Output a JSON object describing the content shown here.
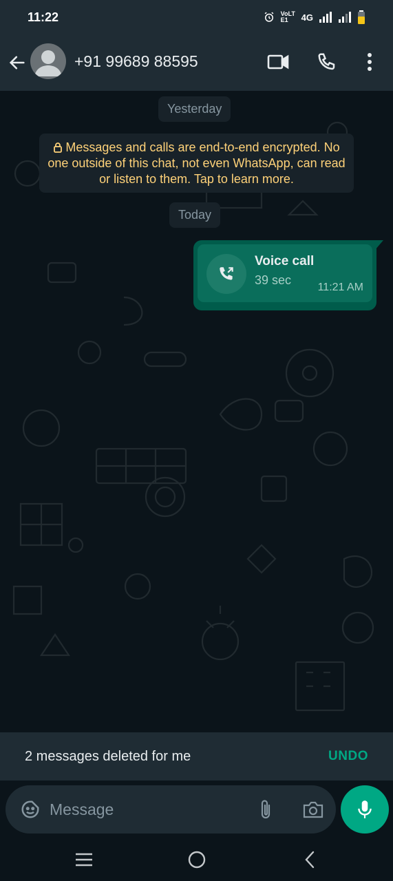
{
  "status_bar": {
    "time": "11:22",
    "network": "4G",
    "volte": "VoLTE1"
  },
  "header": {
    "contact_name": "+91 99689 88595"
  },
  "chat": {
    "date_yesterday": "Yesterday",
    "encryption_notice": "Messages and calls are end-to-end encrypted. No one outside of this chat, not even WhatsApp, can read or listen to them. Tap to learn more.",
    "date_today": "Today",
    "call_message": {
      "title": "Voice call",
      "duration": "39 sec",
      "time": "11:21 AM"
    }
  },
  "snackbar": {
    "text": "2 messages deleted for me",
    "action": "UNDO"
  },
  "composer": {
    "placeholder": "Message"
  },
  "colors": {
    "accent": "#00a884",
    "header_bg": "#1f2c34",
    "chat_bg": "#0b141a",
    "outgoing_bubble": "#005c4b",
    "encryption_text": "#ffd279"
  },
  "icons": {
    "back": "arrow-left-icon",
    "video": "video-camera-icon",
    "call": "phone-icon",
    "menu": "more-vertical-icon",
    "emoji": "sticker-smiley-icon",
    "attach": "paperclip-icon",
    "camera": "camera-icon",
    "mic": "microphone-icon"
  }
}
